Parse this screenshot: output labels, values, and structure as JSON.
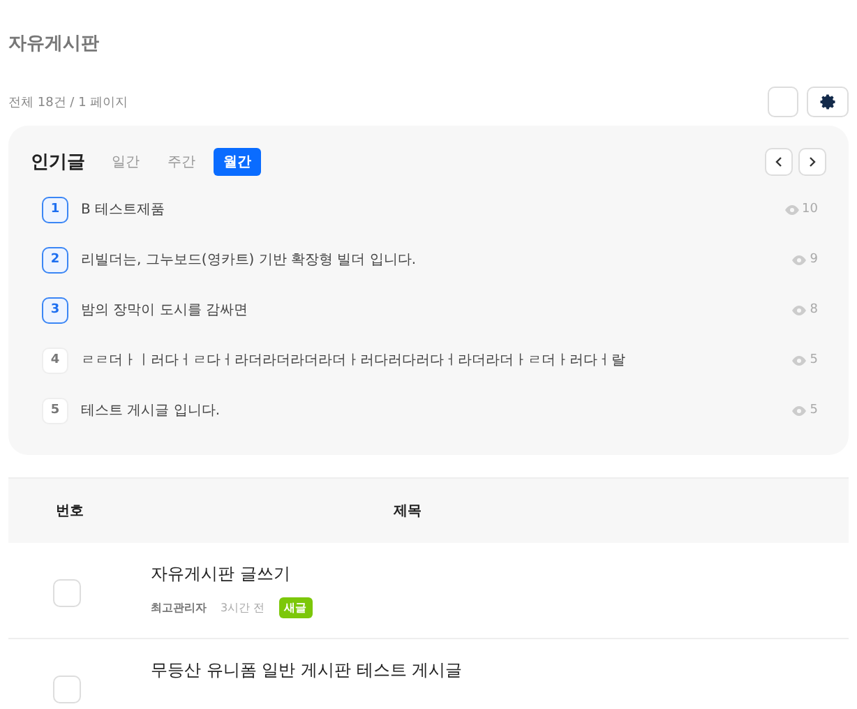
{
  "board_title": "자유게시판",
  "count_text": "전체 18건 / 1 페이지",
  "popular": {
    "title": "인기글",
    "tabs": [
      {
        "label": "일간",
        "selected": false
      },
      {
        "label": "주간",
        "selected": false
      },
      {
        "label": "월간",
        "selected": true
      }
    ],
    "items": [
      {
        "rank": "1",
        "top": true,
        "title": "B 테스트제품",
        "views": "10"
      },
      {
        "rank": "2",
        "top": true,
        "title": "리빌더는, 그누보드(영카트) 기반 확장형 빌더 입니다.",
        "views": "9"
      },
      {
        "rank": "3",
        "top": true,
        "title": "밤의 장막이 도시를 감싸면",
        "views": "8"
      },
      {
        "rank": "4",
        "top": false,
        "title": "ㄹㄹ더ㅏㅣ러다ㅓㄹ다ㅓ라더라더라더라더ㅏ러다러다러다ㅓ라더라더ㅏㄹ더ㅏ러다ㅓ랄",
        "views": "5"
      },
      {
        "rank": "5",
        "top": false,
        "title": "테스트 게시글 입니다.",
        "views": "5"
      }
    ]
  },
  "table": {
    "columns": [
      "번호",
      "제목"
    ],
    "rows": [
      {
        "checked": false,
        "title": "자유게시판 글쓰기",
        "author": "최고관리자",
        "time": "3시간 전",
        "badge": "새글"
      },
      {
        "checked": false,
        "title": "무등산 유니폼 일반 게시판 테스트 게시글"
      }
    ]
  }
}
